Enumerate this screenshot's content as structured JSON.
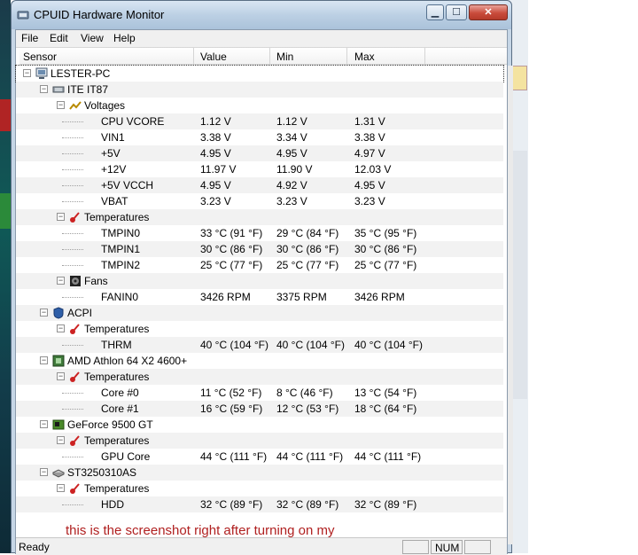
{
  "window": {
    "title": "CPUID Hardware Monitor"
  },
  "menu": [
    "File",
    "Edit",
    "View",
    "Help"
  ],
  "columns": [
    "Sensor",
    "Value",
    "Min",
    "Max"
  ],
  "tree": [
    {
      "level": 0,
      "label": "LESTER-PC",
      "icon": "computer-icon",
      "expander": "−"
    },
    {
      "level": 1,
      "label": "ITE IT87",
      "icon": "chip-icon",
      "expander": "−"
    },
    {
      "level": 2,
      "label": "Voltages",
      "icon": "voltage-icon",
      "expander": "−"
    },
    {
      "level": 3,
      "label": "CPU VCORE",
      "value": "1.12 V",
      "min": "1.12 V",
      "max": "1.31 V"
    },
    {
      "level": 3,
      "label": "VIN1",
      "value": "3.38 V",
      "min": "3.34 V",
      "max": "3.38 V"
    },
    {
      "level": 3,
      "label": "+5V",
      "value": "4.95 V",
      "min": "4.95 V",
      "max": "4.97 V"
    },
    {
      "level": 3,
      "label": "+12V",
      "value": "11.97 V",
      "min": "11.90 V",
      "max": "12.03 V"
    },
    {
      "level": 3,
      "label": "+5V VCCH",
      "value": "4.95 V",
      "min": "4.92 V",
      "max": "4.95 V"
    },
    {
      "level": 3,
      "label": "VBAT",
      "value": "3.23 V",
      "min": "3.23 V",
      "max": "3.23 V"
    },
    {
      "level": 2,
      "label": "Temperatures",
      "icon": "thermometer-icon",
      "expander": "−"
    },
    {
      "level": 3,
      "label": "TMPIN0",
      "value": "33 °C  (91 °F)",
      "min": "29 °C  (84 °F)",
      "max": "35 °C  (95 °F)"
    },
    {
      "level": 3,
      "label": "TMPIN1",
      "value": "30 °C  (86 °F)",
      "min": "30 °C  (86 °F)",
      "max": "30 °C  (86 °F)"
    },
    {
      "level": 3,
      "label": "TMPIN2",
      "value": "25 °C  (77 °F)",
      "min": "25 °C  (77 °F)",
      "max": "25 °C  (77 °F)"
    },
    {
      "level": 2,
      "label": "Fans",
      "icon": "fan-icon",
      "expander": "−"
    },
    {
      "level": 3,
      "label": "FANIN0",
      "value": "3426 RPM",
      "min": "3375 RPM",
      "max": "3426 RPM"
    },
    {
      "level": 1,
      "label": "ACPI",
      "icon": "acpi-shield-icon",
      "expander": "−"
    },
    {
      "level": 2,
      "label": "Temperatures",
      "icon": "thermometer-icon",
      "expander": "−"
    },
    {
      "level": 3,
      "label": "THRM",
      "value": "40 °C  (104 °F)",
      "min": "40 °C  (104 °F)",
      "max": "40 °C  (104 °F)"
    },
    {
      "level": 1,
      "label": "AMD Athlon 64 X2 4600+",
      "icon": "cpu-icon",
      "expander": "−"
    },
    {
      "level": 2,
      "label": "Temperatures",
      "icon": "thermometer-icon",
      "expander": "−"
    },
    {
      "level": 3,
      "label": "Core #0",
      "value": "11 °C  (52 °F)",
      "min": "8 °C  (46 °F)",
      "max": "13 °C  (54 °F)"
    },
    {
      "level": 3,
      "label": "Core #1",
      "value": "16 °C  (59 °F)",
      "min": "12 °C  (53 °F)",
      "max": "18 °C  (64 °F)"
    },
    {
      "level": 1,
      "label": "GeForce 9500 GT",
      "icon": "gpu-icon",
      "expander": "−"
    },
    {
      "level": 2,
      "label": "Temperatures",
      "icon": "thermometer-icon",
      "expander": "−"
    },
    {
      "level": 3,
      "label": "GPU Core",
      "value": "44 °C  (111 °F)",
      "min": "44 °C  (111 °F)",
      "max": "44 °C  (111 °F)"
    },
    {
      "level": 1,
      "label": "ST3250310AS",
      "icon": "hard-drive-icon",
      "expander": "−"
    },
    {
      "level": 2,
      "label": "Temperatures",
      "icon": "thermometer-icon",
      "expander": "−"
    },
    {
      "level": 3,
      "label": "HDD",
      "value": "32 °C  (89 °F)",
      "min": "32 °C  (89 °F)",
      "max": "32 °C  (89 °F)"
    }
  ],
  "annotation": "this is the screenshot right after turning on my pc..",
  "status": {
    "text": "Ready",
    "num": "NUM"
  }
}
